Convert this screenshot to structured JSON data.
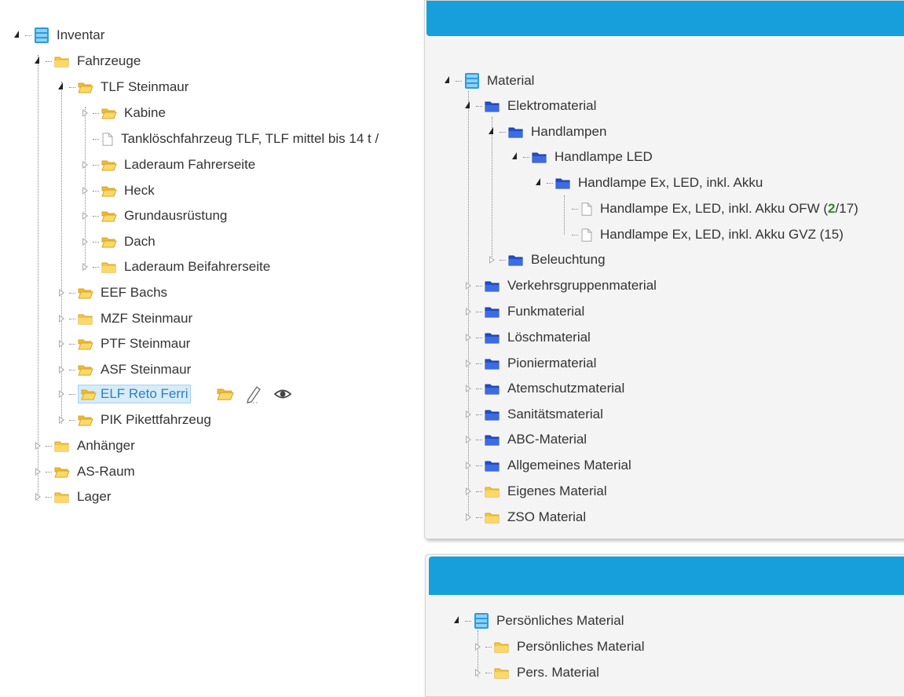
{
  "inventory_tree": {
    "root": "Inventar",
    "fahrzeuge": "Fahrzeuge",
    "tlf": "TLF Steinmaur",
    "tlf_children": [
      "Kabine",
      "Tanklöschfahrzeug TLF, TLF mittel bis 14 t /",
      "Laderaum Fahrerseite",
      "Heck",
      "Grundausrüstung",
      "Dach",
      "Laderaum Beifahrerseite"
    ],
    "vehicles": [
      "EEF Bachs",
      "MZF Steinmaur",
      "PTF Steinmaur",
      "ASF Steinmaur",
      "ELF Reto Ferri",
      "PIK Pikettfahrzeug"
    ],
    "others": [
      "Anhänger",
      "AS-Raum",
      "Lager"
    ]
  },
  "material_panel": {
    "root": "Material",
    "elektro": "Elektromaterial",
    "handlampen": "Handlampen",
    "handlampe_led": "Handlampe LED",
    "handlampe_ex": "Handlampe Ex, LED, inkl. Akku",
    "item1_label": "Handlampe Ex, LED, inkl. Akku OFW (",
    "item1_count": "2",
    "item1_total": "/17)",
    "item2_label": "Handlampe Ex, LED, inkl. Akku GVZ (15)",
    "beleuchtung": "Beleuchtung",
    "categories": [
      "Verkehrsgruppenmaterial",
      "Funkmaterial",
      "Löschmaterial",
      "Pioniermaterial",
      "Atemschutzmaterial",
      "Sanitätsmaterial",
      "ABC-Material",
      "Allgemeines Material"
    ],
    "yellow_categories": [
      "Eigenes Material",
      "ZSO Material"
    ]
  },
  "personal_panel": {
    "root": "Persönliches Material",
    "children": [
      "Persönliches Material",
      "Pers. Material"
    ]
  },
  "colors": {
    "header_blue": "#169fdb",
    "folder_yellow": "#f5c542",
    "folder_blue": "#1f4fcf",
    "selection_bg": "#d6ecf8"
  }
}
